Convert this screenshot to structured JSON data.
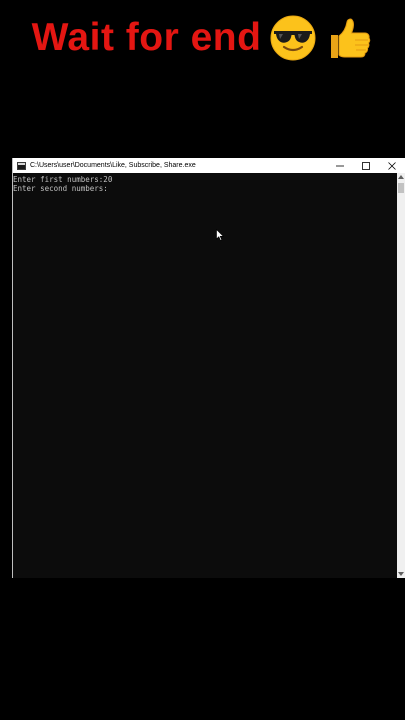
{
  "headline": {
    "text": "Wait for end",
    "emoji_1": "sunglasses-face-icon",
    "emoji_2": "thumbs-up-icon",
    "color": "#e41612"
  },
  "console_window": {
    "title": "C:\\Users\\user\\Documents\\Like, Subscribe, Share.exe",
    "app_icon": "console-app-icon",
    "buttons": {
      "minimize": "minimize-icon",
      "maximize": "maximize-icon",
      "close": "close-icon"
    },
    "lines": [
      "Enter first numbers:20",
      "Enter second numbers:"
    ],
    "background": "#0c0c0c",
    "text_color": "#c0c0c0"
  },
  "cursor": "mouse-pointer-icon"
}
